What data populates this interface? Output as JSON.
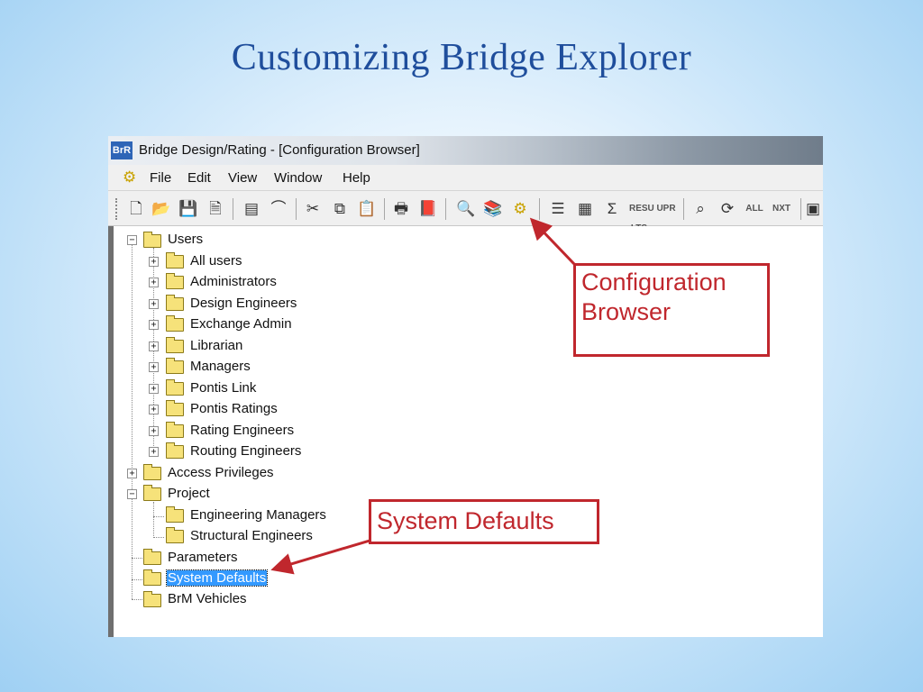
{
  "slide": {
    "title": "Customizing Bridge Explorer"
  },
  "window": {
    "app_icon": "BrR",
    "title": "Bridge Design/Rating - [Configuration Browser]",
    "menu_icon": "gears-icon",
    "menus": [
      "File",
      "Edit",
      "View",
      "Window",
      "Help"
    ],
    "toolbar_text": {
      "resu": "RESU LTS",
      "upr": "UPR",
      "all": "ALL",
      "nxt": "NXT"
    }
  },
  "tree": {
    "users": {
      "label": "Users",
      "children": [
        "All users",
        "Administrators",
        "Design Engineers",
        "Exchange Admin",
        "Librarian",
        "Managers",
        "Pontis Link",
        "Pontis Ratings",
        "Rating Engineers",
        "Routing Engineers"
      ]
    },
    "access_privileges": "Access Privileges",
    "project": {
      "label": "Project",
      "children": [
        "Engineering Managers",
        "Structural Engineers"
      ]
    },
    "parameters": "Parameters",
    "system_defaults": "System Defaults",
    "brm_vehicles": "BrM Vehicles"
  },
  "callouts": {
    "configuration_browser": "Configuration Browser",
    "system_defaults": "System Defaults"
  },
  "colors": {
    "title": "#1f4e9c",
    "callout": "#c0272d",
    "selection": "#3399ff"
  }
}
